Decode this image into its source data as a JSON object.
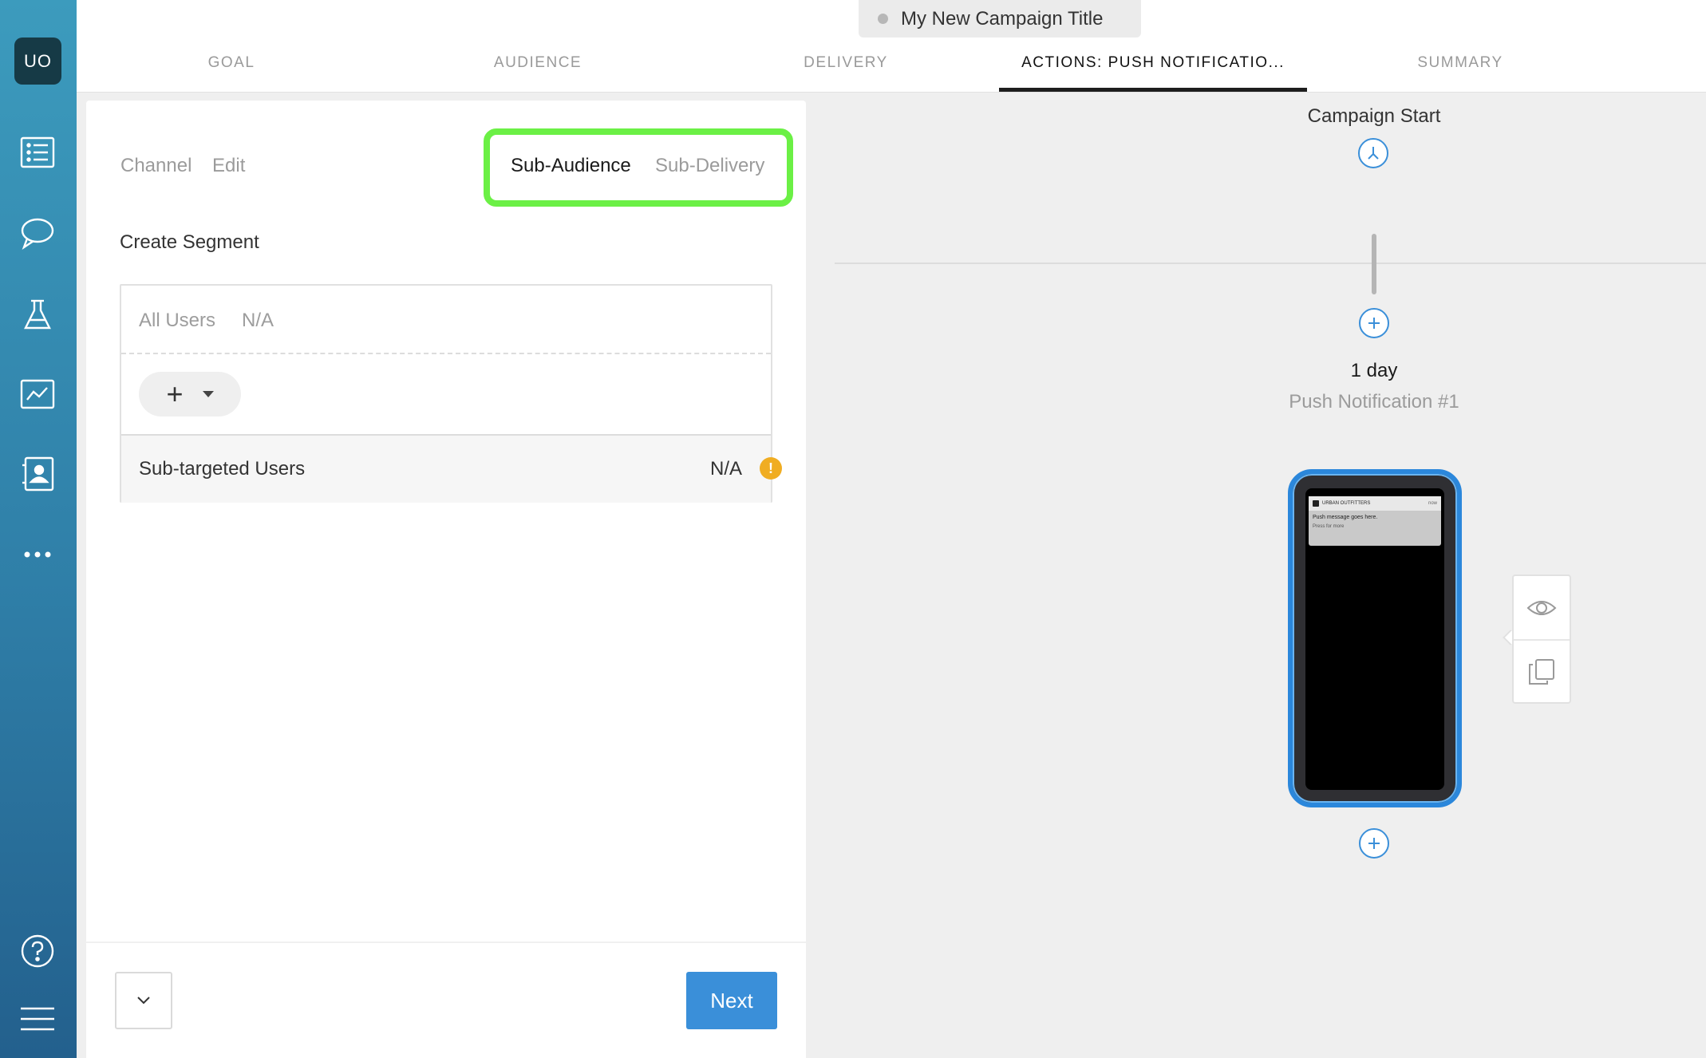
{
  "app": {
    "avatar_initials": "UO",
    "campaign_title": "My New Campaign Title"
  },
  "tabs": [
    {
      "label": "GOAL"
    },
    {
      "label": "AUDIENCE"
    },
    {
      "label": "DELIVERY"
    },
    {
      "label": "ACTIONS: PUSH NOTIFICATIO..."
    },
    {
      "label": "SUMMARY"
    }
  ],
  "active_tab": "ACTIONS: PUSH NOTIFICATIO...",
  "panel": {
    "sub_tabs": [
      {
        "label": "Channel"
      },
      {
        "label": "Edit"
      },
      {
        "label": "Sub-Audience"
      },
      {
        "label": "Sub-Delivery"
      }
    ],
    "active_sub_tab": "Sub-Audience",
    "section_title": "Create Segment",
    "all_users_label": "All Users",
    "all_users_value": "N/A",
    "sub_targeted_label": "Sub-targeted Users",
    "sub_targeted_value": "N/A",
    "warning_glyph": "!",
    "next_label": "Next"
  },
  "canvas": {
    "start_label": "Campaign Start",
    "delay_label": "1 day",
    "step_label": "Push Notification #1",
    "phone_preview": {
      "app_name": "URBAN OUTFITTERS",
      "time": "now",
      "message": "Push message goes here.",
      "more": "Press for more"
    }
  },
  "colors": {
    "accent": "#3a8fd9",
    "highlight": "#6bf045",
    "warning": "#f0ad22",
    "rail_top": "#3c9bbd",
    "rail_bottom": "#23608d"
  },
  "icons": {
    "rail": [
      "list-icon",
      "chat-bubble-icon",
      "flask-icon",
      "chart-icon",
      "contact-book-icon",
      "more-dots-icon",
      "help-icon",
      "menu-icon"
    ]
  }
}
